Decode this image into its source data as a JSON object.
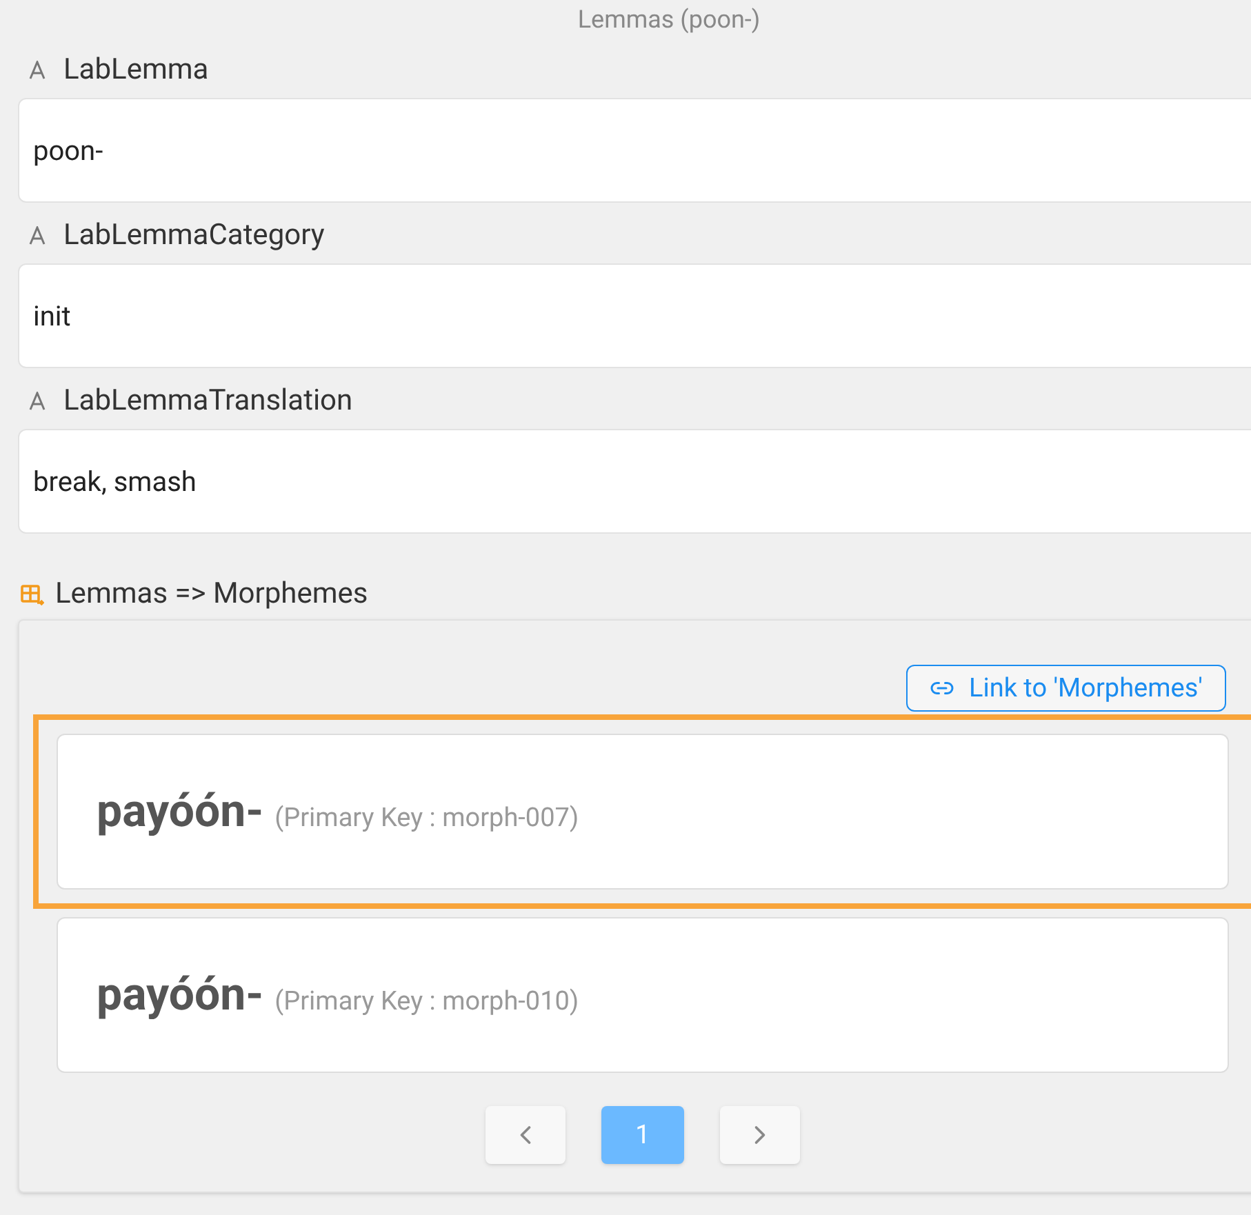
{
  "title": "Lemmas (poon-)",
  "fields": [
    {
      "label": "LabLemma",
      "value": "poon-"
    },
    {
      "label": "LabLemmaCategory",
      "value": "init"
    },
    {
      "label": "LabLemmaTranslation",
      "value": "break, smash"
    }
  ],
  "relation": {
    "label": "Lemmas => Morphemes",
    "link_button": "Link to 'Morphemes'",
    "records": [
      {
        "name": "payóón-",
        "key": "(Primary Key : morph-007)",
        "selected": true
      },
      {
        "name": "payóón-",
        "key": "(Primary Key : morph-010)",
        "selected": false
      }
    ],
    "pages": [
      {
        "label": "1",
        "selected": true
      }
    ]
  }
}
